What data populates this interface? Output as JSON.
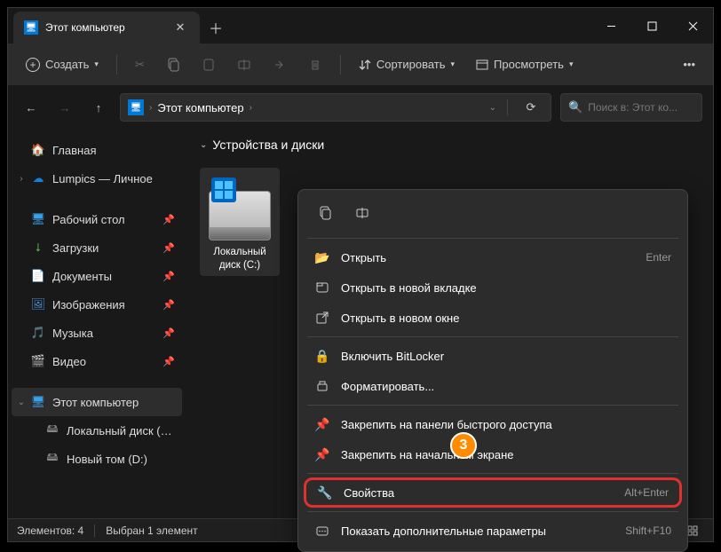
{
  "titlebar": {
    "tab_title": "Этот компьютер"
  },
  "toolbar": {
    "create": "Создать",
    "sort": "Сортировать",
    "view": "Просмотреть"
  },
  "breadcrumb": {
    "root": "Этот компьютер"
  },
  "search": {
    "placeholder": "Поиск в: Этот ко..."
  },
  "sidebar": {
    "home": "Главная",
    "onedrive": "Lumpics — Личное",
    "desktop": "Рабочий стол",
    "downloads": "Загрузки",
    "documents": "Документы",
    "pictures": "Изображения",
    "music": "Музыка",
    "videos": "Видео",
    "thispc": "Этот компьютер",
    "drive_c": "Локальный диск (C:)",
    "drive_d": "Новый том (D:)"
  },
  "content": {
    "group": "Устройства и диски",
    "drive_c_label": "Локальный диск (C:)"
  },
  "ctx": {
    "open": "Открыть",
    "open_shortcut": "Enter",
    "open_tab": "Открыть в новой вкладке",
    "open_win": "Открыть в новом окне",
    "bitlocker": "Включить BitLocker",
    "format": "Форматировать...",
    "pin_quick": "Закрепить на панели быстрого доступа",
    "pin_start": "Закрепить на начальном экране",
    "properties": "Свойства",
    "properties_shortcut": "Alt+Enter",
    "more": "Показать дополнительные параметры",
    "more_shortcut": "Shift+F10"
  },
  "status": {
    "count": "Элементов: 4",
    "selected": "Выбран 1 элемент"
  },
  "annotation": {
    "badge": "3"
  }
}
